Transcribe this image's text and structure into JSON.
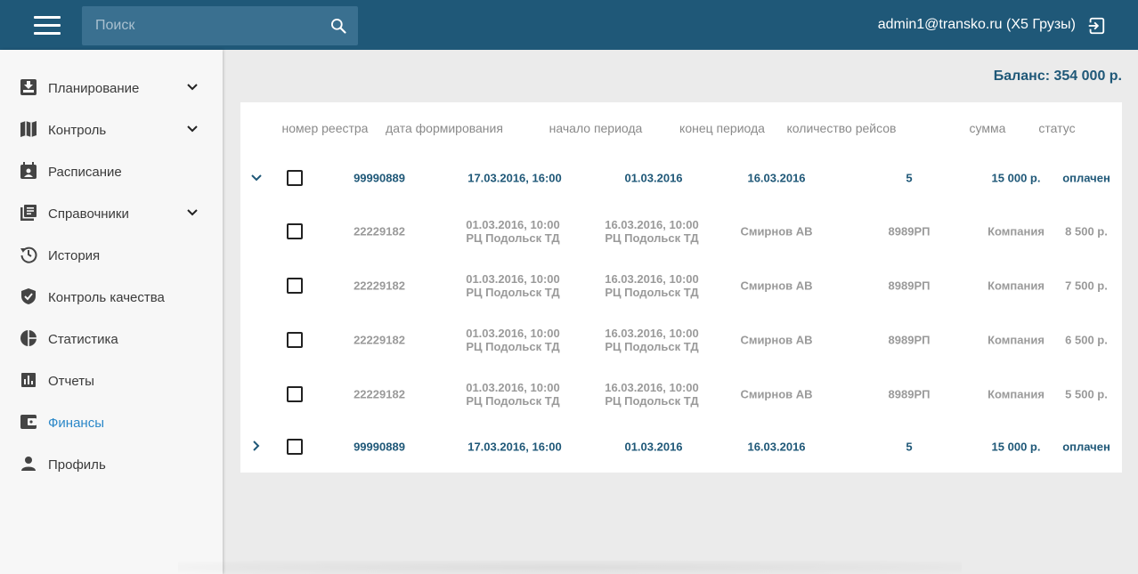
{
  "header": {
    "search_placeholder": "Поиск",
    "user": "admin1@transko.ru (X5 Грузы)"
  },
  "sidebar": {
    "items": [
      {
        "label": "Планирование",
        "icon": "planning-icon",
        "has_chevron": true
      },
      {
        "label": "Контроль",
        "icon": "map-icon",
        "has_chevron": true
      },
      {
        "label": "Расписание",
        "icon": "calendar-icon",
        "has_chevron": false
      },
      {
        "label": "Справочники",
        "icon": "library-icon",
        "has_chevron": true
      },
      {
        "label": "История",
        "icon": "history-icon",
        "has_chevron": false
      },
      {
        "label": "Контроль качества",
        "icon": "shield-check-icon",
        "has_chevron": false
      },
      {
        "label": "Статистика",
        "icon": "pie-chart-icon",
        "has_chevron": false
      },
      {
        "label": "Отчеты",
        "icon": "bar-chart-icon",
        "has_chevron": false
      },
      {
        "label": "Финансы",
        "icon": "wallet-icon",
        "has_chevron": false,
        "active": true
      },
      {
        "label": "Профиль",
        "icon": "person-icon",
        "has_chevron": false
      }
    ]
  },
  "balance": "Баланс: 354 000 р.",
  "table": {
    "headers": [
      "номер реестра",
      "дата формирования",
      "начало периода",
      "конец периода",
      "количество рейсов",
      "сумма",
      "статус"
    ],
    "rows": [
      {
        "type": "main",
        "expanded": true,
        "cells": [
          "99990889",
          "17.03.2016, 16:00",
          "01.03.2016",
          "16.03.2016",
          "5",
          "15 000 р.",
          "оплачен"
        ]
      },
      {
        "type": "sub",
        "cells": [
          "22229182",
          "01.03.2016, 10:00\nРЦ Подольск ТД",
          "16.03.2016, 10:00\nРЦ Подольск ТД",
          "Смирнов АВ",
          "8989РП",
          "Компания",
          "8 500 р."
        ]
      },
      {
        "type": "sub",
        "cells": [
          "22229182",
          "01.03.2016, 10:00\nРЦ Подольск ТД",
          "16.03.2016, 10:00\nРЦ Подольск ТД",
          "Смирнов АВ",
          "8989РП",
          "Компания",
          "7 500 р."
        ]
      },
      {
        "type": "sub",
        "cells": [
          "22229182",
          "01.03.2016, 10:00\nРЦ Подольск ТД",
          "16.03.2016, 10:00\nРЦ Подольск ТД",
          "Смирнов АВ",
          "8989РП",
          "Компания",
          "6 500 р."
        ]
      },
      {
        "type": "sub",
        "cells": [
          "22229182",
          "01.03.2016, 10:00\nРЦ Подольск ТД",
          "16.03.2016, 10:00\nРЦ Подольск ТД",
          "Смирнов АВ",
          "8989РП",
          "Компания",
          "5 500 р."
        ]
      },
      {
        "type": "main",
        "expanded": false,
        "cells": [
          "99990889",
          "17.03.2016, 16:00",
          "01.03.2016",
          "16.03.2016",
          "5",
          "15 000 р.",
          "оплачен"
        ]
      }
    ]
  },
  "colors": {
    "header_bg": "#1f5878",
    "search_bg": "#3a7090",
    "accent": "#2a87c8",
    "main_text": "#1f5878",
    "sub_text": "#9a9a9a"
  }
}
